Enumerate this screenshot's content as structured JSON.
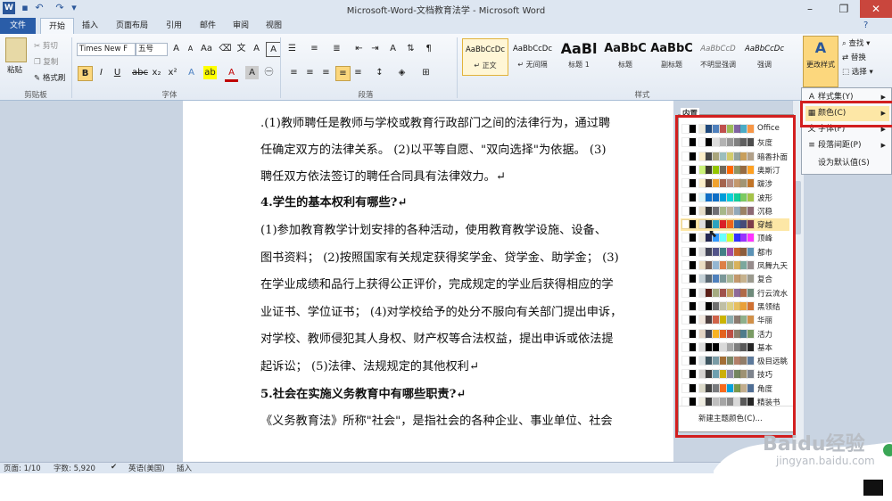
{
  "window": {
    "title": "Microsoft-Word-文档教育法学 - Microsoft Word",
    "controls": [
      "–",
      "❐",
      "✕"
    ]
  },
  "tabs": [
    "文件",
    "开始",
    "插入",
    "页面布局",
    "引用",
    "邮件",
    "审阅",
    "视图"
  ],
  "ribbon": {
    "clipboard": {
      "paste": "粘贴",
      "cut": "剪切",
      "copy": "复制",
      "format_painter": "格式刷",
      "label": "剪贴板"
    },
    "font": {
      "name": "Times New F",
      "size": "五号",
      "label": "字体"
    },
    "paragraph": {
      "label": "段落"
    },
    "styles": {
      "label": "样式",
      "items": [
        {
          "preview": "AaBbCcDc",
          "name": "↵ 正文"
        },
        {
          "preview": "AaBbCcDc",
          "name": "↵ 无间隔"
        },
        {
          "preview": "AaBl",
          "name": "标题 1"
        },
        {
          "preview": "AaBbC",
          "name": "标题"
        },
        {
          "preview": "AaBbC",
          "name": "副标题"
        },
        {
          "preview": "AaBbCcD",
          "name": "不明显强调"
        },
        {
          "preview": "AaBbCcDc",
          "name": "强调"
        }
      ],
      "change_styles": "更改样式"
    },
    "editing": {
      "find": "查找",
      "replace": "替换",
      "select": "选择"
    }
  },
  "document": {
    "lines": [
      {
        "text": ".(1)教师聘任是教师与学校或教育行政部门之间的法律行为，通过聘",
        "bold": false
      },
      {
        "text": "任确定双方的法律关系。 (2)以平等自愿、\"双向选择\"为依据。 (3)",
        "bold": false
      },
      {
        "text": "聘任双方依法签订的聘任合同具有法律效力。↵",
        "bold": false
      },
      {
        "text": "4.学生的基本权利有哪些?↵",
        "bold": true
      },
      {
        "text": "(1)参加教育教学计划安排的各种活动，使用教育教学设施、设备、",
        "bold": false
      },
      {
        "text": "图书资料； (2)按照国家有关规定获得奖学金、贷学金、助学金； (3)",
        "bold": false
      },
      {
        "text": "在学业成绩和品行上获得公正评价，完成规定的学业后获得相应的学",
        "bold": false
      },
      {
        "text": "业证书、学位证书； (4)对学校给予的处分不服向有关部门提出申诉，",
        "bold": false
      },
      {
        "text": "对学校、教师侵犯其人身权、财产权等合法权益，提出申诉或依法提",
        "bold": false
      },
      {
        "text": "起诉讼； (5)法律、法规规定的其他权利↵",
        "bold": false
      },
      {
        "text": "5.社会在实施义务教育中有哪些职责?↵",
        "bold": true
      },
      {
        "text": "《义务教育法》所称\"社会\"，是指社会的各种企业、事业单位、社会",
        "bold": false
      }
    ]
  },
  "color_menu": {
    "header": "内置",
    "new_theme": "新建主题颜色(C)...",
    "themes": [
      {
        "name": "Office",
        "colors": [
          "#ffffff",
          "#000000",
          "#eeece1",
          "#1f497d",
          "#4f81bd",
          "#c0504d",
          "#9bbb59",
          "#8064a2",
          "#4bacc6",
          "#f79646"
        ]
      },
      {
        "name": "灰度",
        "colors": [
          "#ffffff",
          "#000000",
          "#f8f8f8",
          "#000000",
          "#dddddd",
          "#b2b2b2",
          "#969696",
          "#808080",
          "#5f5f5f",
          "#4d4d4d"
        ]
      },
      {
        "name": "暗香扑面",
        "colors": [
          "#ffffff",
          "#000000",
          "#fbeec9",
          "#464646",
          "#a9a57c",
          "#9cbebd",
          "#d2cb6c",
          "#95a39d",
          "#c89f5d",
          "#b1a089"
        ]
      },
      {
        "name": "奥斯汀",
        "colors": [
          "#ffffff",
          "#000000",
          "#caf278",
          "#3e3d2d",
          "#94c600",
          "#71685a",
          "#ff6700",
          "#909465",
          "#956b43",
          "#fea022"
        ]
      },
      {
        "name": "跋涉",
        "colors": [
          "#ffffff",
          "#000000",
          "#fbeec9",
          "#4e3b30",
          "#f0a22e",
          "#a5644e",
          "#b58b80",
          "#c3986d",
          "#a19574",
          "#c17529"
        ]
      },
      {
        "name": "波形",
        "colors": [
          "#ffffff",
          "#000000",
          "#dbf5f9",
          "#0f6fc6",
          "#0f6fc6",
          "#009dd9",
          "#0bd0d9",
          "#10cf9b",
          "#7cca62",
          "#a5c249"
        ]
      },
      {
        "name": "沉稳",
        "colors": [
          "#ffffff",
          "#000000",
          "#e7dec9",
          "#383838",
          "#6f6f74",
          "#a7b789",
          "#beae98",
          "#92a9b9",
          "#9c8265",
          "#8d6974"
        ]
      },
      {
        "name": "穿越",
        "colors": [
          "#ffffff",
          "#000000",
          "#dedede",
          "#1f2123",
          "#2da2bf",
          "#da1f28",
          "#eb641b",
          "#39639d",
          "#474b78",
          "#7d3c4a"
        ]
      },
      {
        "name": "顶峰",
        "colors": [
          "#ffffff",
          "#000000",
          "#eeece1",
          "#242852",
          "#3399ff",
          "#69ffff",
          "#ccff33",
          "#3333ff",
          "#9933ff",
          "#ff33ff"
        ]
      },
      {
        "name": "都市",
        "colors": [
          "#ffffff",
          "#000000",
          "#dedede",
          "#424456",
          "#53548a",
          "#438086",
          "#a04da3",
          "#c4652d",
          "#8b5d3d",
          "#5c92b5"
        ]
      },
      {
        "name": "凤舞九天",
        "colors": [
          "#ffffff",
          "#000000",
          "#ebddc3",
          "#775f55",
          "#94b6d2",
          "#dd8047",
          "#a5ab81",
          "#d8b25c",
          "#7ba79d",
          "#968c8c"
        ]
      },
      {
        "name": "复合",
        "colors": [
          "#ffffff",
          "#000000",
          "#c5d1d7",
          "#5b6973",
          "#4f81bd",
          "#7b9899",
          "#a8b89a",
          "#c3986d",
          "#c6b28e",
          "#9b9a8e"
        ]
      },
      {
        "name": "行云流水",
        "colors": [
          "#ffffff",
          "#000000",
          "#e6e6e6",
          "#5a1f18",
          "#a5ab81",
          "#a0534c",
          "#c29f5e",
          "#8e6a99",
          "#b06b48",
          "#6f8b7b"
        ]
      },
      {
        "name": "黑领结",
        "colors": [
          "#ffffff",
          "#000000",
          "#f2f2f2",
          "#000000",
          "#6f6f6f",
          "#bfbfa5",
          "#dcd084",
          "#e7bf5f",
          "#e9a039",
          "#cf7133"
        ]
      },
      {
        "name": "华丽",
        "colors": [
          "#ffffff",
          "#000000",
          "#f2e8df",
          "#4f4040",
          "#d16349",
          "#ccb400",
          "#8cadae",
          "#8c7b70",
          "#8fb08c",
          "#d19049"
        ]
      },
      {
        "name": "活力",
        "colors": [
          "#ffffff",
          "#000000",
          "#e2d3c4",
          "#454551",
          "#f8b323",
          "#e3621f",
          "#bd4e43",
          "#8a7e6b",
          "#4f7c8b",
          "#7a9b64"
        ]
      },
      {
        "name": "基本",
        "colors": [
          "#ffffff",
          "#000000",
          "#dddddd",
          "#000000",
          "#000000",
          "#d9d9d9",
          "#a6a6a6",
          "#7f7f7f",
          "#595959",
          "#262626"
        ]
      },
      {
        "name": "极目远眺",
        "colors": [
          "#ffffff",
          "#000000",
          "#dde4e6",
          "#3e5661",
          "#7a9ca6",
          "#a36f36",
          "#7a8766",
          "#b3806a",
          "#917e6a",
          "#5d7a9b"
        ]
      },
      {
        "name": "技巧",
        "colors": [
          "#ffffff",
          "#000000",
          "#d4d2d0",
          "#3b3b3b",
          "#6ea0b0",
          "#ccaf0a",
          "#8d89a4",
          "#748560",
          "#9e9273",
          "#7e848d"
        ]
      },
      {
        "name": "角度",
        "colors": [
          "#ffffff",
          "#000000",
          "#dbd9c9",
          "#434342",
          "#797b7e",
          "#f96a1b",
          "#08a1d9",
          "#7c984a",
          "#c2ad8d",
          "#506e94"
        ]
      },
      {
        "name": "精装书",
        "colors": [
          "#ffffff",
          "#000000",
          "#eeece1",
          "#3f3f3f",
          "#bfbfbf",
          "#a5a5a5",
          "#8c8c8c",
          "#d9d9d9",
          "#595959",
          "#262626"
        ]
      }
    ],
    "selected": "穿越"
  },
  "change_styles_menu": {
    "items": [
      {
        "label": "样式集(Y)",
        "arrow": "▶"
      },
      {
        "label": "颜色(C)",
        "arrow": "▶"
      },
      {
        "label": "字体(F)",
        "arrow": "▶"
      },
      {
        "label": "段落间距(P)",
        "arrow": "▶"
      },
      {
        "label": "设为默认值(S)",
        "arrow": ""
      }
    ]
  },
  "status": {
    "page": "页面: 1/10",
    "words": "字数: 5,920",
    "lang": "英语(美国)",
    "mode": "插入"
  },
  "watermark": {
    "logo": "Baidu经验",
    "url": "jingyan.baidu.com"
  }
}
